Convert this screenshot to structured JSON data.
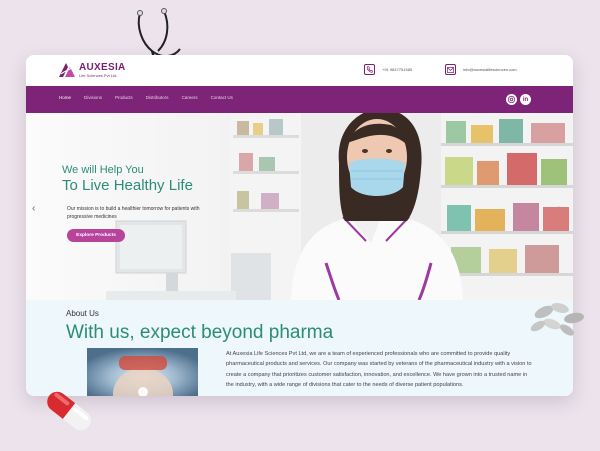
{
  "brand": {
    "name": "AUXESIA",
    "subtitle": "Life Sciences Pvt Ltd.",
    "color": "#7a1f73"
  },
  "contact": {
    "phone": "+91 9847751585",
    "email": "info@auxesialifesciences.com"
  },
  "nav": {
    "items": [
      "Home",
      "Divisions",
      "Products",
      "Distributors",
      "Careers",
      "Contact Us"
    ],
    "active": "Home",
    "color": "#7d2478"
  },
  "social": [
    "instagram-icon",
    "linkedin-icon"
  ],
  "hero": {
    "subtitle": "We will Help You",
    "title": "To Live Healthy Life",
    "description": "Our mission is to build a healthier tomorrow for patients with progressive medicines",
    "button": "Explore Products",
    "accent": "#2b8d78",
    "button_color": "#b8439b"
  },
  "about": {
    "label": "About Us",
    "title": "With us, expect beyond pharma",
    "text": "At Auxesia Life Sciences Pvt Ltd, we are a team of experienced professionals who are committed to provide quality pharmaceutical products and services. Our company was started by veterans of the pharmaceutical industry with a vision to create a company that prioritizes customer satisfaction, innovation, and excellence. We have grown into a trusted name in the industry, with a wide range of divisions that cater to the needs of diverse patient populations."
  }
}
